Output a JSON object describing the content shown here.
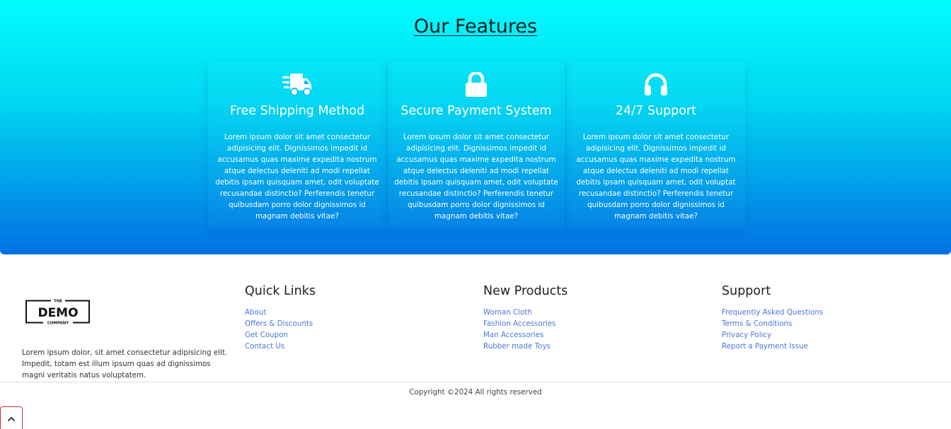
{
  "features": {
    "title": "Our Features",
    "cards": [
      {
        "icon": "shipping-truck-icon",
        "title": "Free Shipping Method",
        "text": "Lorem ipsum dolor sit amet consectetur adipisicing elit. Dignissimos impedit id accusamus quas maxime expedita nostrum atque delectus deleniti ad modi repellat debitis ipsam quisquam amet, odit voluptate recusandae distinctio? Perferendis tenetur quibusdam porro dolor dignissimos id magnam debitis vitae?"
      },
      {
        "icon": "lock-icon",
        "title": "Secure Payment System",
        "text": "Lorem ipsum dolor sit amet consectetur adipisicing elit. Dignissimos impedit id accusamus quas maxime expedita nostrum atque delectus deleniti ad modi repellat debitis ipsam quisquam amet, odit voluptate recusandae distinctio? Perferendis tenetur quibusdam porro dolor dignissimos id magnam debitis vitae?"
      },
      {
        "icon": "headphones-icon",
        "title": "24/7 Support",
        "text": "Lorem ipsum dolor sit amet consectetur adipisicing elit. Dignissimos impedit id accusamus quas maxime expedita nostrum atque delectus deleniti ad modi repellat debitis ipsam quisquam amet, odit voluptat recusandae distinctio? Perferendis tenetur quibusdam porro dolor dignissimos id magnam debitis vitae?"
      }
    ]
  },
  "footer": {
    "logo": {
      "top_text": "THE",
      "main_text": "DEMO",
      "bottom_text": "COMPANY"
    },
    "about": "Lorem ipsum dolor, sit amet consectetur adipisicing elit. Impedit, totam est illum ipsum quas ad dignissimos magni veritatis natus voluptatem.",
    "columns": [
      {
        "heading": "Quick Links",
        "links": [
          "About",
          "Offers & Discounts",
          "Get Coupon",
          "Contact Us"
        ]
      },
      {
        "heading": "New Products",
        "links": [
          "Woman Cloth",
          "Fashion Accessories",
          "Man Accessories",
          "Rubber made Toys"
        ]
      },
      {
        "heading": "Support",
        "links": [
          "Frequently Asked Questions",
          "Terms & Conditions",
          "Privacy Policy",
          "Report a Payment Issue"
        ]
      }
    ],
    "copyright": "Copyright ©2024 All rights reserved"
  },
  "scroll_top": {
    "icon": "chevron-up-icon"
  },
  "colors": {
    "gradient_top": "#00fdfd",
    "gradient_bottom": "#0270e3",
    "link": "#4a78d8",
    "scroll_button_border": "#c53030"
  }
}
